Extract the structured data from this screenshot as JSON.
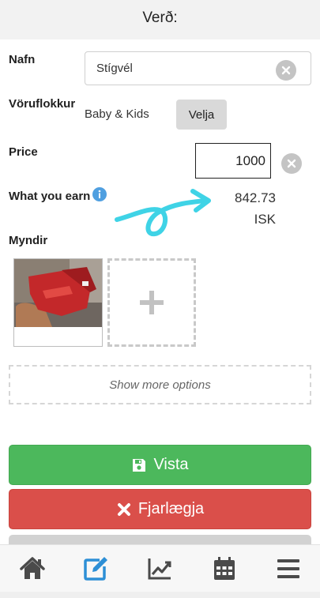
{
  "header": {
    "title": "Verð:"
  },
  "form": {
    "name_label": "Nafn",
    "name_value": "Stígvél",
    "category_label": "Vöruflokkur",
    "category_value": "Baby & Kids",
    "choose_label": "Velja",
    "price_label": "Price",
    "price_value": "1000",
    "earn_label": "What you earn",
    "earn_amount": "842.73",
    "earn_currency": "ISK",
    "photos_label": "Myndir",
    "more_options_label": "Show more options"
  },
  "actions": {
    "save_label": "Vista",
    "delete_label": "Fjarlægja"
  },
  "icons": {
    "clear": "close-icon",
    "info": "info-icon",
    "add_photo": "plus-icon",
    "save": "floppy-disk-icon",
    "delete": "x-icon",
    "annotation": "arrow-annotation"
  },
  "nav": {
    "items": [
      {
        "icon": "home-icon",
        "active": false
      },
      {
        "icon": "edit-icon",
        "active": true
      },
      {
        "icon": "chart-icon",
        "active": false
      },
      {
        "icon": "calendar-icon",
        "active": false
      },
      {
        "icon": "menu-icon",
        "active": false
      }
    ]
  },
  "colors": {
    "save": "#4cb85c",
    "delete": "#da4f4a",
    "active_nav": "#2d8fd6",
    "nav_icon": "#4a4a4a",
    "annotation": "#3fd3e6",
    "info": "#4f9fe0"
  }
}
